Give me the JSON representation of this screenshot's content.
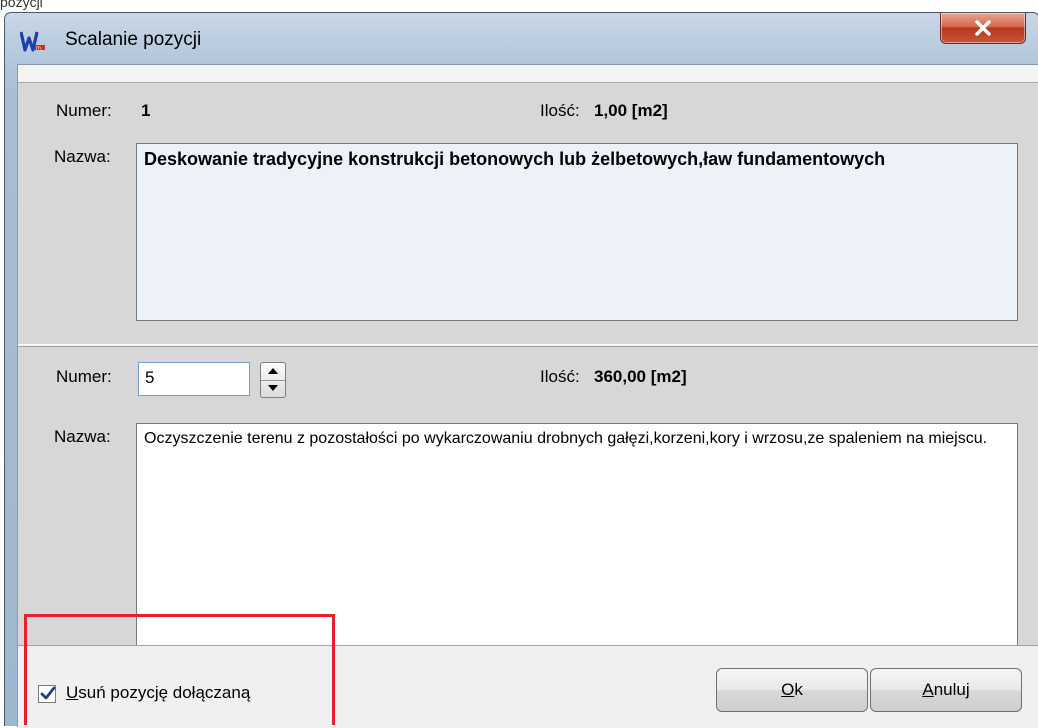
{
  "fragment_top": "pozycji",
  "window": {
    "title": "Scalanie pozycji"
  },
  "position1": {
    "numer_label": "Numer:",
    "numer_value": "1",
    "ilosc_label": "Ilość:",
    "ilosc_value": "1,00 [m2]",
    "nazwa_label": "Nazwa:",
    "nazwa_value": "Deskowanie tradycyjne konstrukcji betonowych lub żelbetowych,ław fundamentowych"
  },
  "position2": {
    "numer_label": "Numer:",
    "numer_value": "5",
    "ilosc_label": "Ilość:",
    "ilosc_value": "360,00 [m2]",
    "nazwa_label": "Nazwa:",
    "nazwa_value": "Oczyszczenie terenu z pozostałości po wykarczowaniu drobnych gałęzi,korzeni,kory i wrzosu,ze spaleniem na miejscu."
  },
  "bottom": {
    "checkbox_checked": true,
    "checkbox_label_mnemonic": "U",
    "checkbox_label_rest": "suń pozycję dołączaną",
    "ok_mnemonic": "O",
    "ok_rest": "k",
    "cancel_mnemonic": "A",
    "cancel_rest": "nuluj"
  },
  "colors": {
    "highlight": "#e8202a",
    "close_button": "#c95536"
  },
  "icons": [
    "app-logo-icon",
    "close-icon",
    "spin-up-icon",
    "spin-down-icon",
    "checkmark-icon"
  ]
}
